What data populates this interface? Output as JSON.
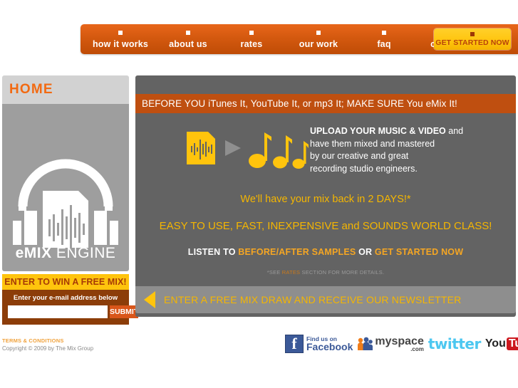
{
  "nav": {
    "items": [
      {
        "id": "how-it-works",
        "label": "how it works"
      },
      {
        "id": "about-us",
        "label": "about us"
      },
      {
        "id": "rates",
        "label": "rates"
      },
      {
        "id": "our-work",
        "label": "our work"
      },
      {
        "id": "faq",
        "label": "faq"
      },
      {
        "id": "contact",
        "label": "contact"
      }
    ],
    "cta_label": "GET STARTED NOW",
    "bar_color": "#d4590f",
    "cta_color": "#ffc40d"
  },
  "sidebar": {
    "page_title": "HOME",
    "logo": {
      "name_bold": "eMIX",
      "name_light": " ENGINE",
      "icon": "headphones-waveform-logo"
    },
    "signup": {
      "heading": "ENTER TO WIN A FREE MIX!",
      "sub_label": "Enter your e-mail address below",
      "email_value": "",
      "email_placeholder": "",
      "submit_label": "SUBMIT"
    }
  },
  "main": {
    "headline": "BEFORE YOU iTunes It, YouTube It, or mp3 It; MAKE SURE You eMix It!",
    "upload": {
      "icon_document": "waveform-document-icon",
      "icon_arrow": "play-arrow-icon",
      "icon_notes": "music-notes-icon",
      "line1_bold": "UPLOAD YOUR MUSIC & VIDEO",
      "line1_rest": " and",
      "line2": "have them mixed and mastered",
      "line3": "by our creative and great",
      "line4": "recording studio engineers."
    },
    "line_days": "We'll have your mix back in 2 DAYS!*",
    "line_easy": "EASY TO USE, FAST, INEXPENSIVE and SOUNDS WORLD CLASS!",
    "listen": {
      "prefix": "LISTEN TO ",
      "link1": "BEFORE/AFTER SAMPLES",
      "middle": " OR ",
      "link2": "GET STARTED NOW"
    },
    "footnote": {
      "prefix": "*SEE ",
      "link": "RATES",
      "suffix": " SECTION FOR MORE DETAILS."
    },
    "newsletter": "ENTER A FREE MIX DRAW AND RECEIVE OUR NEWSLETTER",
    "panel_color": "#636363",
    "headline_bar_color": "#bf4f10",
    "accent_yellow": "#f5b600"
  },
  "footer": {
    "terms_label": "TERMS & CONDITIONS",
    "copyright": "Copyright © 2009 by The Mix Group",
    "social": {
      "facebook_small": "Find us on",
      "facebook_big": "Facebook",
      "facebook_glyph": "f",
      "myspace_name": "myspace",
      "myspace_dotcom": ".com",
      "twitter": "twitter",
      "youtube_you": "You",
      "youtube_tube": "Tube",
      "youtube_tm": "™"
    }
  }
}
